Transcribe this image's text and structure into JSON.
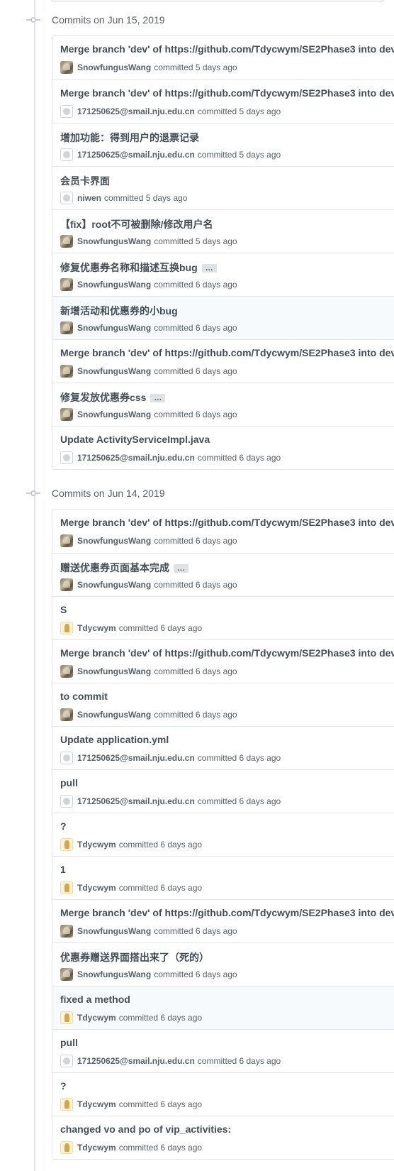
{
  "groups": [
    {
      "title": "Commits on Jun 15, 2019",
      "commits": [
        {
          "message": "Merge branch 'dev' of https://github.com/Tdycwym/SE2Phase3 into dev",
          "author": "SnowfungusWang",
          "avatar": "snow-avatar",
          "time": "committed 5 days ago",
          "ellipsis": false,
          "highlight": false
        },
        {
          "message": "Merge branch 'dev' of https://github.com/Tdycwym/SE2Phase3 into dev",
          "author": "171250625@smail.nju.edu.cn",
          "avatar": "github-default-avatar",
          "time": "committed 5 days ago",
          "ellipsis": false,
          "highlight": false
        },
        {
          "message": "增加功能：得到用户的退票记录",
          "author": "171250625@smail.nju.edu.cn",
          "avatar": "github-default-avatar",
          "time": "committed 5 days ago",
          "ellipsis": false,
          "highlight": false
        },
        {
          "message": "会员卡界面",
          "author": "niwen",
          "avatar": "github-default-avatar",
          "time": "committed 5 days ago",
          "ellipsis": false,
          "highlight": false
        },
        {
          "message": "【fix】root不可被删除/修改用户名",
          "author": "SnowfungusWang",
          "avatar": "snow-avatar",
          "time": "committed 5 days ago",
          "ellipsis": false,
          "highlight": false
        },
        {
          "message": "修复优惠券名称和描述互换bug",
          "author": "SnowfungusWang",
          "avatar": "snow-avatar",
          "time": "committed 6 days ago",
          "ellipsis": true,
          "highlight": false
        },
        {
          "message": "新增活动和优惠券的小bug",
          "author": "SnowfungusWang",
          "avatar": "snow-avatar",
          "time": "committed 6 days ago",
          "ellipsis": false,
          "highlight": true
        },
        {
          "message": "Merge branch 'dev' of https://github.com/Tdycwym/SE2Phase3 into dev",
          "author": "SnowfungusWang",
          "avatar": "snow-avatar",
          "time": "committed 6 days ago",
          "ellipsis": false,
          "highlight": false
        },
        {
          "message": "修复发放优惠券css",
          "author": "SnowfungusWang",
          "avatar": "snow-avatar",
          "time": "committed 6 days ago",
          "ellipsis": true,
          "highlight": false
        },
        {
          "message": "Update ActivityServiceImpl.java",
          "author": "171250625@smail.nju.edu.cn",
          "avatar": "github-default-avatar",
          "time": "committed 6 days ago",
          "ellipsis": false,
          "highlight": false
        }
      ]
    },
    {
      "title": "Commits on Jun 14, 2019",
      "commits": [
        {
          "message": "Merge branch 'dev' of https://github.com/Tdycwym/SE2Phase3 into dev",
          "author": "SnowfungusWang",
          "avatar": "snow-avatar",
          "time": "committed 6 days ago",
          "ellipsis": false,
          "highlight": false
        },
        {
          "message": "赠送优惠券页面基本完成",
          "author": "SnowfungusWang",
          "avatar": "snow-avatar",
          "time": "committed 6 days ago",
          "ellipsis": true,
          "highlight": false
        },
        {
          "message": "S",
          "author": "Tdycwym",
          "avatar": "tdycwym-avatar",
          "time": "committed 6 days ago",
          "ellipsis": false,
          "highlight": false
        },
        {
          "message": "Merge branch 'dev' of https://github.com/Tdycwym/SE2Phase3 into dev",
          "author": "SnowfungusWang",
          "avatar": "snow-avatar",
          "time": "committed 6 days ago",
          "ellipsis": false,
          "highlight": false
        },
        {
          "message": "to commit",
          "author": "SnowfungusWang",
          "avatar": "snow-avatar",
          "time": "committed 6 days ago",
          "ellipsis": false,
          "highlight": false
        },
        {
          "message": "Update application.yml",
          "author": "171250625@smail.nju.edu.cn",
          "avatar": "github-default-avatar",
          "time": "committed 6 days ago",
          "ellipsis": false,
          "highlight": false
        },
        {
          "message": "pull",
          "author": "171250625@smail.nju.edu.cn",
          "avatar": "github-default-avatar",
          "time": "committed 6 days ago",
          "ellipsis": false,
          "highlight": false
        },
        {
          "message": "?",
          "author": "Tdycwym",
          "avatar": "tdycwym-avatar",
          "time": "committed 6 days ago",
          "ellipsis": false,
          "highlight": false
        },
        {
          "message": "1",
          "author": "Tdycwym",
          "avatar": "tdycwym-avatar",
          "time": "committed 6 days ago",
          "ellipsis": false,
          "highlight": false
        },
        {
          "message": "Merge branch 'dev' of https://github.com/Tdycwym/SE2Phase3 into dev",
          "author": "SnowfungusWang",
          "avatar": "snow-avatar",
          "time": "committed 6 days ago",
          "ellipsis": false,
          "highlight": false
        },
        {
          "message": "优惠券赠送界面搭出来了（死的）",
          "author": "SnowfungusWang",
          "avatar": "snow-avatar",
          "time": "committed 6 days ago",
          "ellipsis": false,
          "highlight": false
        },
        {
          "message": "fixed a method",
          "author": "Tdycwym",
          "avatar": "tdycwym-avatar",
          "time": "committed 6 days ago",
          "ellipsis": false,
          "highlight": true
        },
        {
          "message": "pull",
          "author": "171250625@smail.nju.edu.cn",
          "avatar": "github-default-avatar",
          "time": "committed 6 days ago",
          "ellipsis": false,
          "highlight": false
        },
        {
          "message": "?",
          "author": "Tdycwym",
          "avatar": "tdycwym-avatar",
          "time": "committed 6 days ago",
          "ellipsis": false,
          "highlight": false
        },
        {
          "message": "changed vo and po of vip_activities:",
          "author": "Tdycwym",
          "avatar": "tdycwym-avatar",
          "time": "committed 6 days ago",
          "ellipsis": false,
          "highlight": false
        }
      ]
    }
  ],
  "ellipsis_label": "…"
}
